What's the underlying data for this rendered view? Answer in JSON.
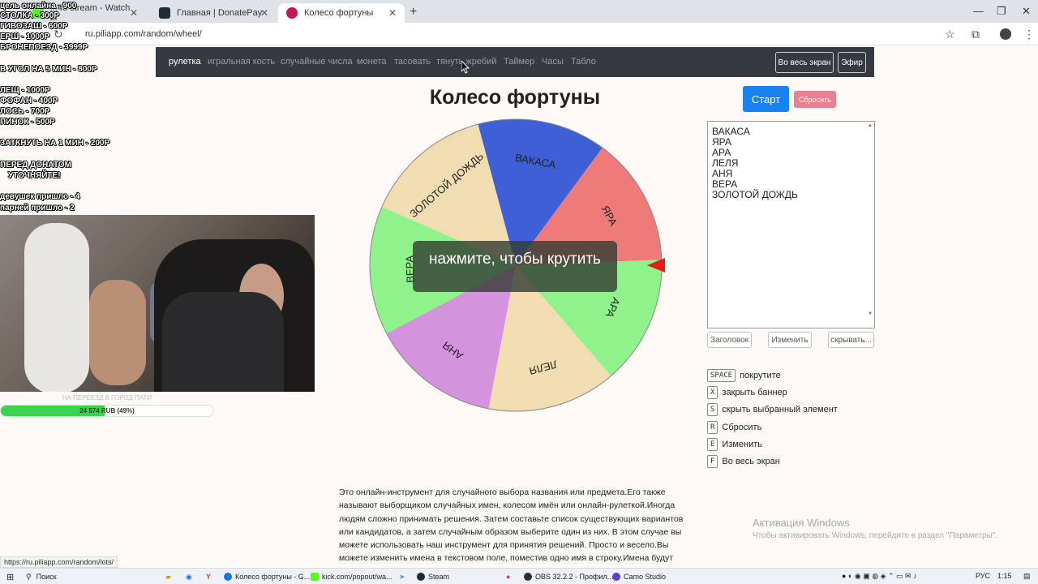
{
  "browser": {
    "tabs": [
      {
        "label": "...43 stream - Watch Li",
        "icon_color": "#53fc18"
      },
      {
        "label": "Главная | DonatePay",
        "icon_color": "#1c2c39"
      },
      {
        "label": "Колесо фортуны",
        "icon_color": "#c2185b"
      }
    ],
    "url": "ru.piliapp.com/random/wheel/",
    "status_link": "https://ru.piliapp.com/random/lots/"
  },
  "site": {
    "nav": [
      "рулетка",
      "игральная кость",
      "случайные числа",
      "монета",
      "тасовать",
      "тянуть жребий",
      "Таймер",
      "Часы",
      "Табло"
    ],
    "fullscreen_button": "Во весь экран",
    "broadcast_button": "Эфир",
    "title": "Колесо фортуны",
    "start_button": "Старт",
    "reset_button": "Сбросить",
    "overlay_text": "нажмите, чтобы крутить",
    "names": [
      "ВАКАСА",
      "ЯРА",
      "АРА",
      "ЛЕЛЯ",
      "АНЯ",
      "ВЕРА",
      "ЗОЛОТОЙ ДОЖДЬ"
    ],
    "settings_buttons": [
      "Заголовок",
      "Изменить",
      "скрывать..."
    ],
    "shortcuts": [
      {
        "key": "SPACE",
        "label": "покрутите"
      },
      {
        "key": "X",
        "label": "закрыть баннер"
      },
      {
        "key": "S",
        "label": "скрыть выбранный элемент"
      },
      {
        "key": "R",
        "label": "Сбросить"
      },
      {
        "key": "E",
        "label": "Изменить"
      },
      {
        "key": "F",
        "label": "Во весь экран"
      }
    ],
    "description": "Это онлайн-инструмент для случайного выбора названия или предмета.Его также называют выборщиком случайных имен, колесом имён или онлайн-рулеткой.Иногда людям сложно принимать решения. Затем составьте список существующих вариантов или кандидатов, а затем случайным образом выберите один из них. В этом случае вы можете использовать наш инструмент для принятия решений. Просто и весело.Вы можете изменить имена в текстовом поле, поместив одно имя в строку.Имена будут"
  },
  "wheel": {
    "segments": [
      {
        "label": "ВАКАСА",
        "color": "#3f5fd6"
      },
      {
        "label": "ЯРА",
        "color": "#ef7a7a"
      },
      {
        "label": "АРА",
        "color": "#8ff28a"
      },
      {
        "label": "ЛЕЛЯ",
        "color": "#f2dcb2"
      },
      {
        "label": "АНЯ",
        "color": "#d493dd"
      },
      {
        "label": "ВЕРА",
        "color": "#8ff28a"
      },
      {
        "label": "ЗОЛОТОЙ ДОЖДЬ",
        "color": "#f2dcb2"
      }
    ],
    "pointer_color": "#e41b1b"
  },
  "activation": {
    "title": "Активация Windows",
    "subtitle": "Чтобы активировать Windows, перейдите в раздел \"Параметры\"."
  },
  "stream_overlay": {
    "lines": [
      "цель онлайна - 900",
      "СТОЛКА - 300Р",
      "ГИВОЗАШ - 600Р",
      "ЕРШ - 1000Р",
      "БРОНЕПОЕЗД - 3999Р",
      "В УГОЛ НА 5 МИН - 800Р",
      "ЛЕЩ - 1000Р",
      "ФОФАН - 400Р",
      "ЛОСЬ - 700Р",
      "ПИНОК - 500Р",
      "ЗАТКНУТЬ НА 1 МИН - 200Р",
      "ПЕРЕД ДОНАТОМ",
      "УТОЧНЯЙТЕ!",
      "девушек пришло - 4",
      "парней пришло - 2"
    ],
    "goal_label": "НА ПЕРЕЕЗД В ГОРОД ПАТИ",
    "goal_text": "24 574 RUB (49%)",
    "goal_percent": 49
  },
  "taskbar": {
    "search": "Поиск",
    "apps": [
      {
        "label": "Колесо фортуны - G...",
        "color": "#1a73e8"
      },
      {
        "label": "kick.com/popout/wa...",
        "color": "#53fc18"
      },
      {
        "label": "Steam",
        "color": "#1b2838"
      },
      {
        "label": "OBS 32.2.2 - Профил...",
        "color": "#302e31"
      },
      {
        "label": "Camo Studio",
        "color": "#5b3fd1"
      }
    ],
    "lang": "РУС",
    "time": "1:15"
  }
}
